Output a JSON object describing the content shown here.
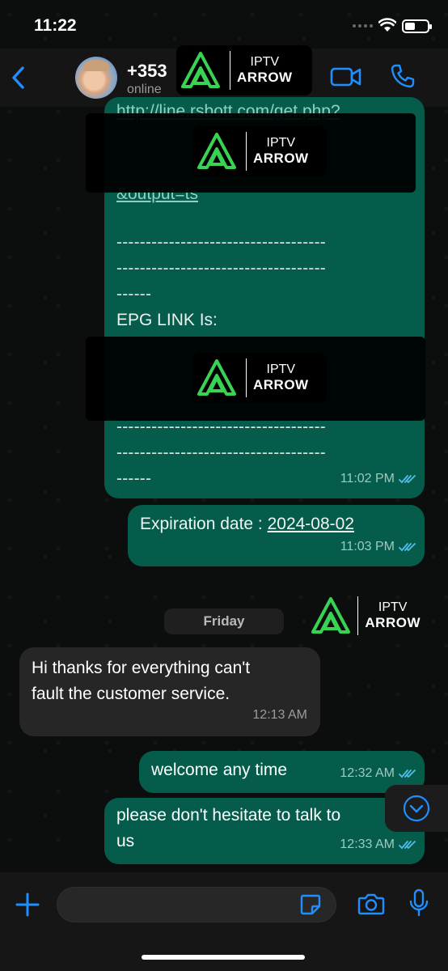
{
  "status_bar": {
    "time": "11:22",
    "battery_level": 0.45
  },
  "header": {
    "contact_name": "+353",
    "contact_status": "online"
  },
  "logo": {
    "line1": "IPTV",
    "line2": "ARROW",
    "accent": "#39d353"
  },
  "messages": {
    "m1": {
      "link_line1": "http://line.rsbott.com/get.php?",
      "link_line2": "&output=ts",
      "dashes1": "------------------------------------",
      "dashes2": "------------------------------------",
      "dashes3": "------",
      "epg_label": "EPG LINK Is:",
      "dashes4": "------------------------------------",
      "dashes5": "------------------------------------",
      "dashes6": "------",
      "time": "11:02 PM"
    },
    "m2": {
      "label": "Expiration date : ",
      "date": "2024-08-02",
      "time": "11:03 PM"
    },
    "day": "Friday",
    "m3": {
      "line1": "Hi thanks for everything  can't",
      "line2": "fault the customer service.",
      "time": "12:13 AM"
    },
    "m4": {
      "text": "welcome any time",
      "time": "12:32 AM"
    },
    "m5": {
      "line1": "please  don't hesitate to talk to",
      "line2": "us",
      "time": "12:33 AM"
    }
  },
  "colors": {
    "accent_blue": "#1f8fff",
    "outgoing_bubble": "#055c4b",
    "incoming_bubble": "#262626",
    "read_ticks": "#53bdeb"
  }
}
